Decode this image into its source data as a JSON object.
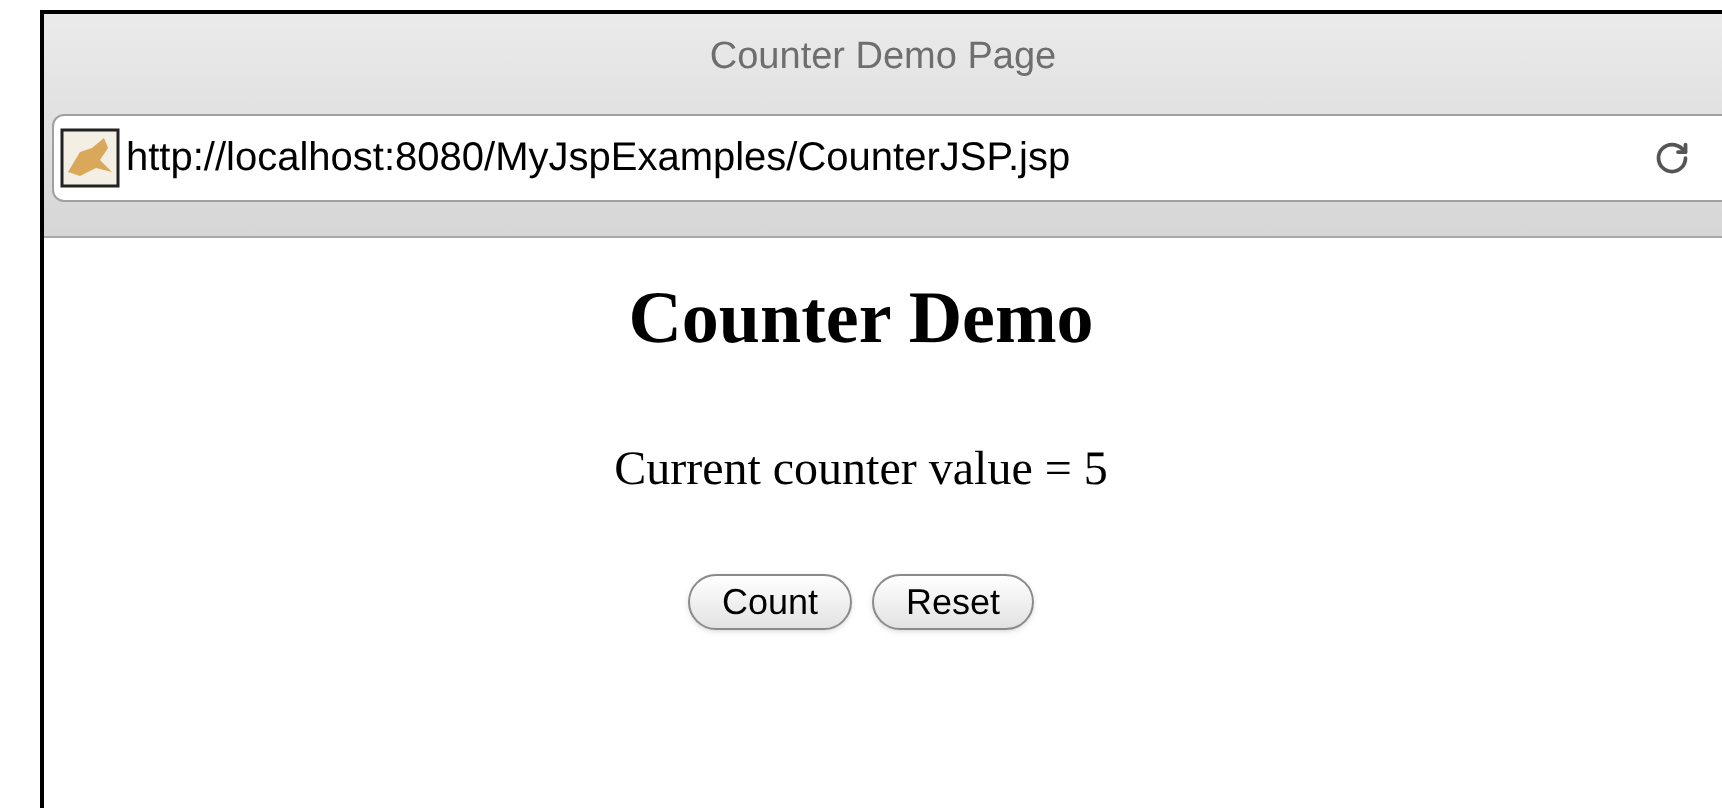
{
  "window": {
    "title": "Counter Demo Page"
  },
  "address_bar": {
    "url": "http://localhost:8080/MyJspExamples/CounterJSP.jsp"
  },
  "page": {
    "heading": "Counter Demo",
    "text": "Current counter value = 5",
    "buttons": [
      {
        "label": "Count"
      },
      {
        "label": "Reset"
      }
    ]
  }
}
